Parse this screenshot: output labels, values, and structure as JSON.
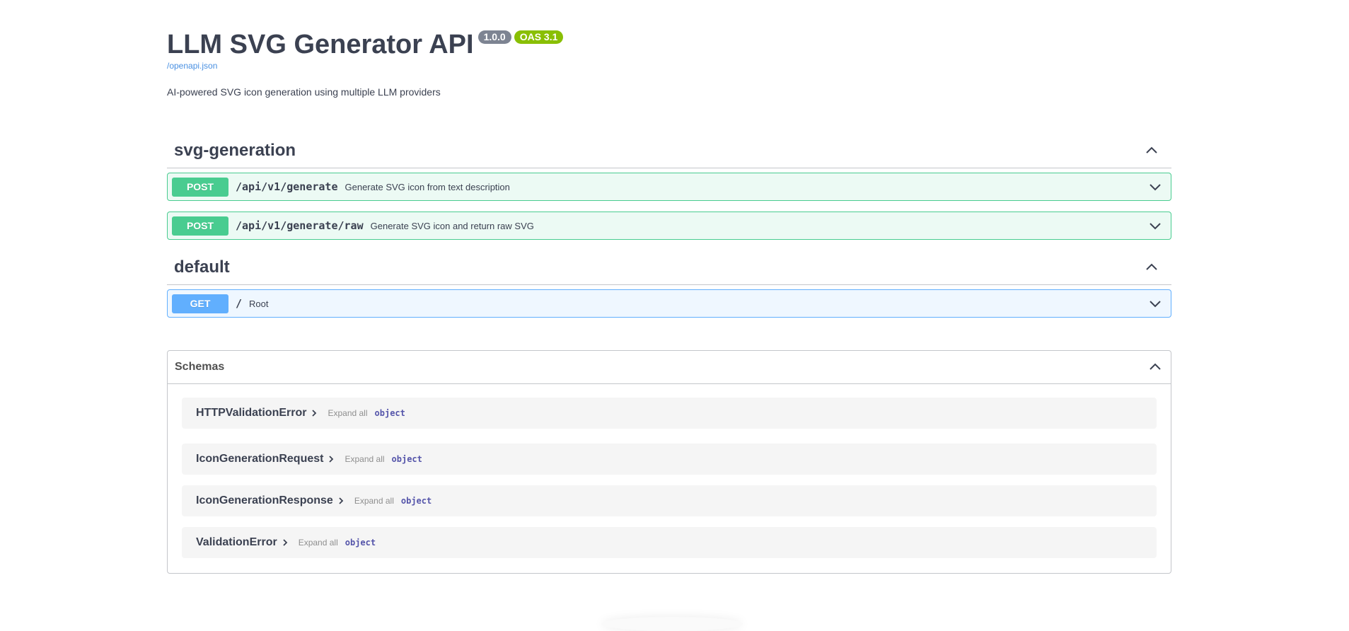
{
  "info": {
    "title": "LLM SVG Generator API",
    "version": "1.0.0",
    "oas": "OAS 3.1",
    "spec_link": "/openapi.json",
    "description": "AI-powered SVG icon generation using multiple LLM providers"
  },
  "tags": [
    {
      "name": "svg-generation",
      "operations": [
        {
          "method": "POST",
          "path": "/api/v1/generate",
          "summary": "Generate SVG icon from text description"
        },
        {
          "method": "POST",
          "path": "/api/v1/generate/raw",
          "summary": "Generate SVG icon and return raw SVG"
        }
      ]
    },
    {
      "name": "default",
      "operations": [
        {
          "method": "GET",
          "path": "/",
          "summary": "Root"
        }
      ]
    }
  ],
  "schemas": {
    "title": "Schemas",
    "items": [
      {
        "name": "HTTPValidationError",
        "expand_label": "Expand all",
        "type": "object"
      },
      {
        "name": "IconGenerationRequest",
        "expand_label": "Expand all",
        "type": "object"
      },
      {
        "name": "IconGenerationResponse",
        "expand_label": "Expand all",
        "type": "object"
      },
      {
        "name": "ValidationError",
        "expand_label": "Expand all",
        "type": "object"
      }
    ]
  },
  "colors": {
    "post": "#49cc90",
    "get": "#61affe",
    "version_badge": "#7d8492",
    "oas_badge": "#89bf04",
    "link": "#4990e2"
  }
}
